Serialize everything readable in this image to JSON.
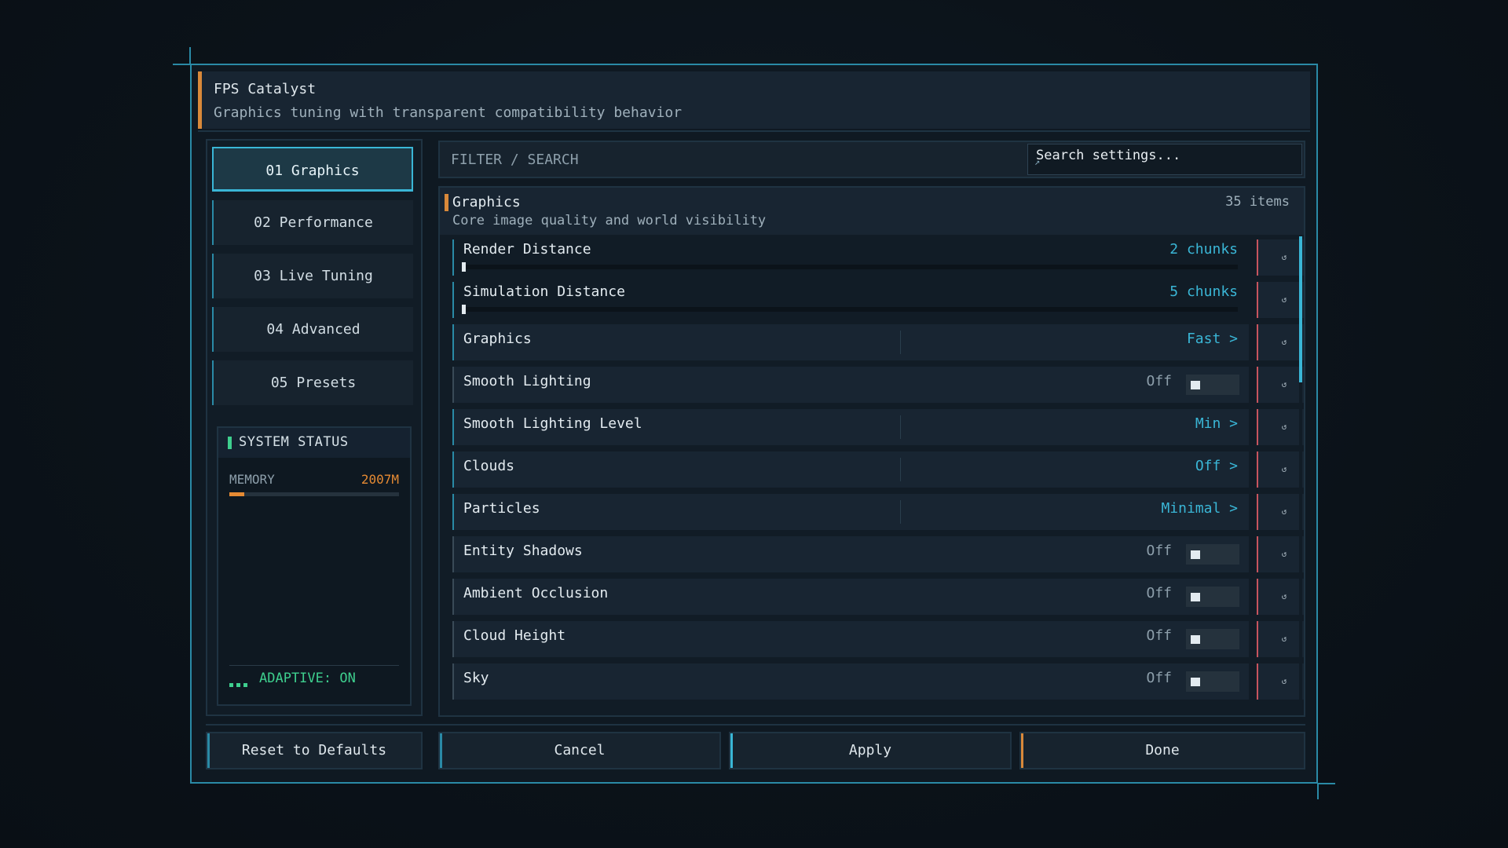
{
  "app": {
    "title": "FPS Catalyst",
    "subtitle": "Graphics tuning with transparent compatibility behavior"
  },
  "sidebar": {
    "items": [
      {
        "label": "01  Graphics",
        "active": true
      },
      {
        "label": "02  Performance",
        "active": false
      },
      {
        "label": "03  Live Tuning",
        "active": false
      },
      {
        "label": "04  Advanced",
        "active": false
      },
      {
        "label": "05  Presets",
        "active": false
      }
    ]
  },
  "status": {
    "title": "SYSTEM STATUS",
    "memory_label": "MEMORY",
    "memory_value": "2007M",
    "memory_fraction": 0.09,
    "adaptive": "ADAPTIVE: ON"
  },
  "search": {
    "label": "FILTER / SEARCH",
    "placeholder": "Search settings..."
  },
  "section": {
    "title": "Graphics",
    "description": "Core image quality and world visibility",
    "count": "35 items"
  },
  "settings": [
    {
      "name": "Render Distance",
      "type": "slider",
      "value": "2 chunks",
      "fraction": 0.0
    },
    {
      "name": "Simulation Distance",
      "type": "slider",
      "value": "5 chunks",
      "fraction": 0.0
    },
    {
      "name": "Graphics",
      "type": "cycle",
      "value": "Fast >"
    },
    {
      "name": "Smooth Lighting",
      "type": "toggle",
      "value": "Off"
    },
    {
      "name": "Smooth Lighting Level",
      "type": "cycle",
      "value": "Min >"
    },
    {
      "name": "Clouds",
      "type": "cycle",
      "value": "Off >"
    },
    {
      "name": "Particles",
      "type": "cycle",
      "value": "Minimal >"
    },
    {
      "name": "Entity Shadows",
      "type": "toggle",
      "value": "Off"
    },
    {
      "name": "Ambient Occlusion",
      "type": "toggle",
      "value": "Off"
    },
    {
      "name": "Cloud Height",
      "type": "toggle",
      "value": "Off"
    },
    {
      "name": "Sky",
      "type": "toggle",
      "value": "Off"
    }
  ],
  "reset_icon_glyph": "↺",
  "footer": {
    "reset": "Reset to Defaults",
    "cancel": "Cancel",
    "apply": "Apply",
    "done": "Done"
  },
  "colors": {
    "accent_cyan": "#3ab6d6",
    "accent_orange": "#d9893a",
    "accent_green": "#3ecf8e",
    "reset_red": "#c8545e"
  }
}
